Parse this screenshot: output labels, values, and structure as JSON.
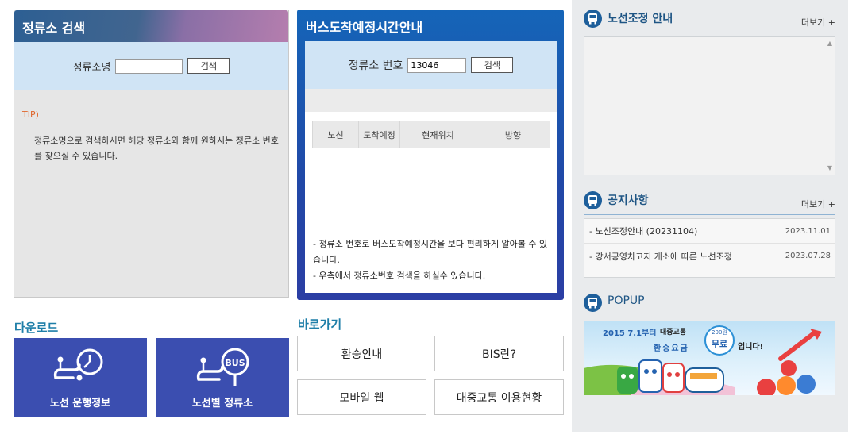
{
  "stop_search": {
    "title": "정류소 검색",
    "field_label": "정류소명",
    "field_value": "",
    "search_button": "검색",
    "tip_title": "TIP)",
    "tip_text": "정류소명으로 검색하시면 해당 정류소와 함께 원하시는 정류소 번호를 찾으실 수 있습니다."
  },
  "arrival": {
    "title": "버스도착예정시간안내",
    "field_label": "정류소 번호",
    "field_value": "13046",
    "search_button": "검색",
    "columns": [
      "노선",
      "도착예정",
      "현재위치",
      "방향"
    ],
    "notes": [
      "- 정류소 번호로 버스도착예정시간을 보다 편리하게 알아볼 수 있습니다.",
      "- 우측에서 정류소번호 검색을 하실수 있습니다."
    ]
  },
  "downloads": {
    "title": "다운로드",
    "items": [
      {
        "label": "노선 운행정보",
        "icon": "route-clock-icon"
      },
      {
        "label": "노선별 정류소",
        "icon": "route-bus-icon"
      }
    ]
  },
  "shortcuts": {
    "title": "바로가기",
    "items": [
      "환승안내",
      "BIS란?",
      "모바일 웹",
      "대중교통 이용현황"
    ]
  },
  "route_adjust": {
    "title": "노선조정 안내",
    "more": "더보기 +"
  },
  "notices": {
    "title": "공지사항",
    "more": "더보기 +",
    "items": [
      {
        "title": "- 노선조정안내 (20231104)",
        "date": "2023.11.01"
      },
      {
        "title": "- 강서공영차고지 개소에 따른 노선조정",
        "date": "2023.07.28"
      }
    ]
  },
  "popup": {
    "title": "POPUP",
    "banner_date": "2015 7.1부터",
    "banner_brand": "대중교통",
    "banner_slogan": "환승요금",
    "banner_badge_top": "200원",
    "banner_badge": "무료",
    "banner_end": "입니다!"
  },
  "colors": {
    "accent_blue": "#1e5f9b",
    "arrival_blue": "#1565b8",
    "download_blue": "#3b4eb0",
    "tip_orange": "#e0652a"
  }
}
